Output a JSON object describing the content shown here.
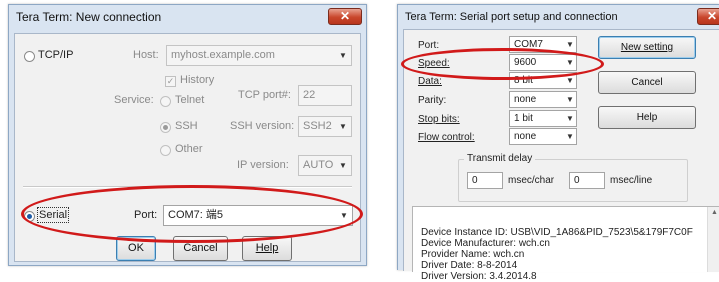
{
  "left_dialog": {
    "title": "Tera Term: New connection",
    "close_glyph": "✕",
    "tcpip_label": "TCP/IP",
    "host_label": "Host:",
    "host_value": "myhost.example.com",
    "history_label": "History",
    "service_label": "Service:",
    "telnet_label": "Telnet",
    "tcp_port_label": "TCP port#:",
    "tcp_port_value": "22",
    "ssh_label": "SSH",
    "ssh_version_label": "SSH version:",
    "ssh_version_value": "SSH2",
    "other_label": "Other",
    "ip_version_label": "IP version:",
    "ip_version_value": "AUTO",
    "serial_label": "Serial",
    "port_label": "Port:",
    "port_value": "COM7: 端5",
    "ok_label": "OK",
    "cancel_label": "Cancel",
    "help_label": "Help"
  },
  "right_dialog": {
    "title": "Tera Term: Serial port setup and connection",
    "port_label": "Port:",
    "port_value": "COM7",
    "speed_label": "Speed:",
    "speed_value": "9600",
    "data_label": "Data:",
    "data_value": "8 bit",
    "parity_label": "Parity:",
    "parity_value": "none",
    "stop_bits_label": "Stop bits:",
    "stop_bits_value": "1 bit",
    "flow_control_label": "Flow control:",
    "flow_control_value": "none",
    "new_setting_label": "New setting",
    "cancel_label": "Cancel",
    "help_label": "Help",
    "transmit_delay_label": "Transmit delay",
    "char_delay_value": "0",
    "char_delay_unit": "msec/char",
    "line_delay_value": "0",
    "line_delay_unit": "msec/line",
    "device_info": [
      "Device Instance ID: USB\\VID_1A86&PID_7523\\5&179F7C0F",
      "Device Manufacturer: wch.cn",
      "Provider Name: wch.cn",
      "Driver Date: 8-8-2014",
      "Driver Version: 3.4.2014.8"
    ]
  },
  "colors": {
    "highlight_ellipse": "#d11a1a",
    "titlebar": "#d9e4f1",
    "close_button": "#c9462c"
  },
  "icons": {
    "close": "close-icon",
    "dropdown": "chevron-down-icon",
    "scroll_up": "scroll-up-icon"
  }
}
